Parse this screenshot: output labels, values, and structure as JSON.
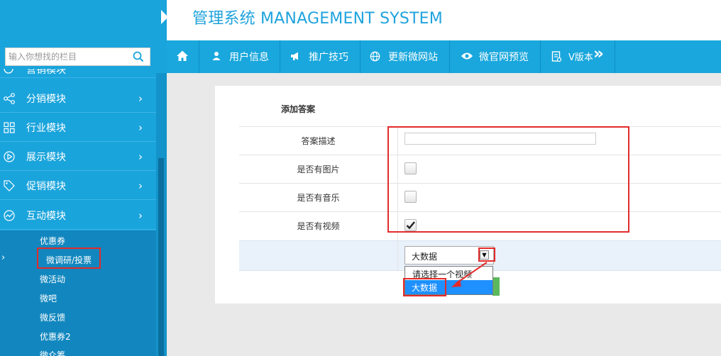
{
  "app": {
    "title": "管理系统 MANAGEMENT SYSTEM"
  },
  "search": {
    "placeholder": "输入你想找的栏目"
  },
  "sidebar": {
    "partial_item_label": "营销模块",
    "items": [
      {
        "label": "分销模块",
        "icon": "share-icon"
      },
      {
        "label": "行业模块",
        "icon": "grid-icon"
      },
      {
        "label": "展示模块",
        "icon": "play-icon"
      },
      {
        "label": "促销模块",
        "icon": "tag-icon"
      },
      {
        "label": "互动模块",
        "icon": "chart-line-icon"
      }
    ],
    "subitems": [
      "优惠券",
      "微调研/投票",
      "微活动",
      "微吧",
      "微反馈",
      "优惠券2",
      "微众筹"
    ],
    "chevron": "›"
  },
  "topnav": {
    "items": [
      {
        "label": "",
        "icon": "home-icon"
      },
      {
        "label": "用户信息",
        "icon": "user-icon"
      },
      {
        "label": "推广技巧",
        "icon": "megaphone-icon"
      },
      {
        "label": "更新微网站",
        "icon": "globe-icon"
      },
      {
        "label": "微官网预览",
        "icon": "eye-icon"
      },
      {
        "label": "V版本",
        "icon": "document-icon"
      }
    ],
    "more": "»"
  },
  "form": {
    "heading": "添加答案",
    "rows": [
      {
        "label": "答案描述",
        "type": "text",
        "value": ""
      },
      {
        "label": "是否有图片",
        "type": "checkbox",
        "checked": false
      },
      {
        "label": "是否有音乐",
        "type": "checkbox",
        "checked": false
      },
      {
        "label": "是否有视频",
        "type": "checkbox",
        "checked": true
      }
    ],
    "select": {
      "value": "大数据",
      "arrow": "▼",
      "options": [
        "请选择一个视频",
        "大数据"
      ]
    }
  },
  "colors": {
    "accent": "#1aa4dc",
    "highlight": "#e32b2b",
    "selected": "#1e90ff"
  }
}
